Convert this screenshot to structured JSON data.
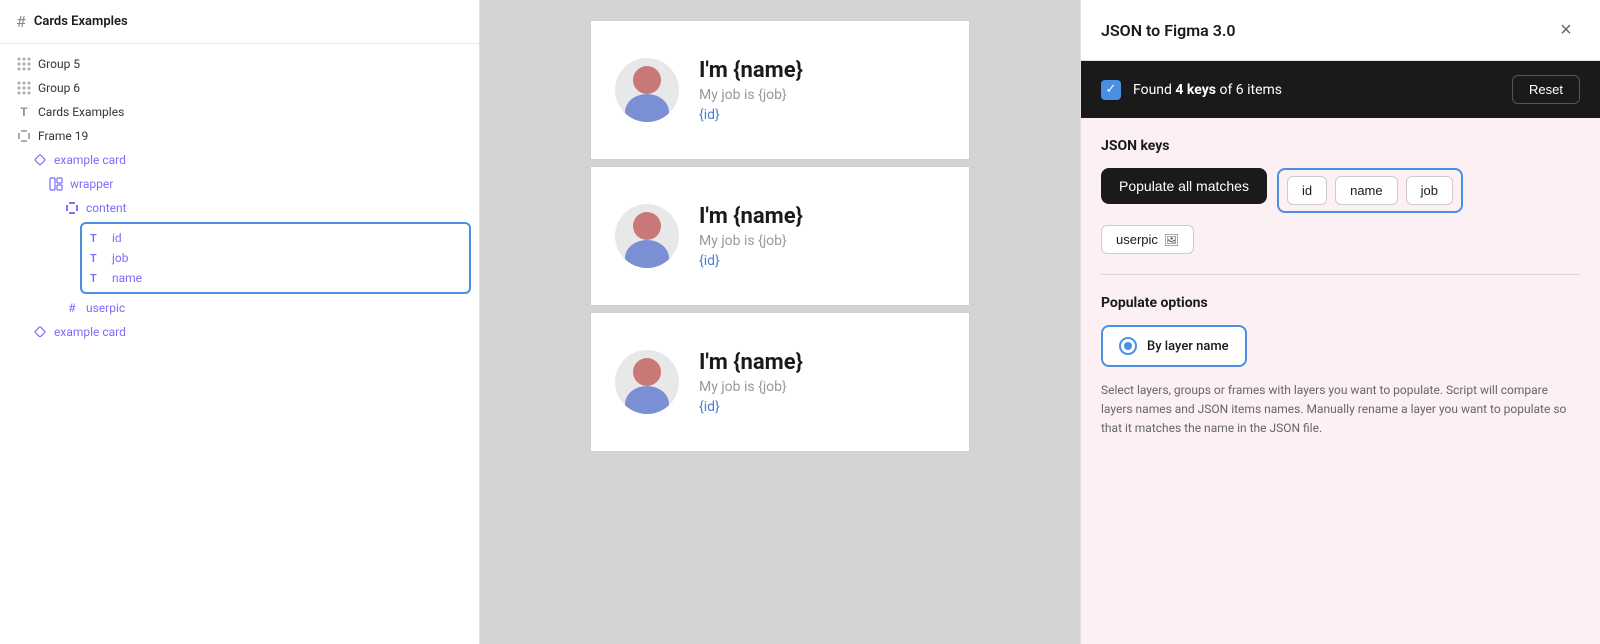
{
  "layers": {
    "header": {
      "icon": "#",
      "title": "Cards Examples"
    },
    "items": [
      {
        "id": "group5",
        "indent": 0,
        "icon": "grid",
        "label": "Group 5",
        "color": "default"
      },
      {
        "id": "group6",
        "indent": 0,
        "icon": "grid",
        "label": "Group 6",
        "color": "default"
      },
      {
        "id": "cards-examples",
        "indent": 0,
        "icon": "T",
        "label": "Cards Examples",
        "color": "default"
      },
      {
        "id": "frame19",
        "indent": 0,
        "icon": "frame",
        "label": "Frame 19",
        "color": "default"
      },
      {
        "id": "example-card-1",
        "indent": 1,
        "icon": "diamond",
        "label": "example card",
        "color": "blue"
      },
      {
        "id": "wrapper",
        "indent": 2,
        "icon": "layout",
        "label": "wrapper",
        "color": "blue"
      },
      {
        "id": "content",
        "indent": 3,
        "icon": "frame",
        "label": "content",
        "color": "blue"
      },
      {
        "id": "id-layer",
        "indent": 4,
        "icon": "T",
        "label": "id",
        "color": "blue",
        "selected": true
      },
      {
        "id": "job-layer",
        "indent": 4,
        "icon": "T",
        "label": "job",
        "color": "blue",
        "selected": true
      },
      {
        "id": "name-layer",
        "indent": 4,
        "icon": "T",
        "label": "name",
        "color": "blue",
        "selected": true
      },
      {
        "id": "userpic",
        "indent": 3,
        "icon": "hash",
        "label": "userpic",
        "color": "blue"
      },
      {
        "id": "example-card-2",
        "indent": 1,
        "icon": "diamond",
        "label": "example card",
        "color": "blue"
      }
    ]
  },
  "cards": [
    {
      "name": "I'm {name}",
      "job": "My job is {job}",
      "id": "{id}"
    },
    {
      "name": "I'm {name}",
      "job": "My job is {job}",
      "id": "{id}"
    },
    {
      "name": "I'm {name}",
      "job": "My job is {job}",
      "id": "{id}"
    }
  ],
  "right_panel": {
    "title": "JSON to Figma 3.0",
    "close_label": "×",
    "found_bar": {
      "keys_count": "4",
      "items_count": "6",
      "text_pre": "Found ",
      "text_keys": "4 keys",
      "text_of": " of ",
      "text_items": "6 items",
      "reset_label": "Reset"
    },
    "json_keys": {
      "section_title": "JSON keys",
      "populate_btn": "Populate all matches",
      "keys": [
        "id",
        "name",
        "job"
      ],
      "userpic_key": "userpic"
    },
    "populate_options": {
      "section_title": "Populate options",
      "by_layer_name": "By layer name",
      "description": "Select layers, groups or frames with layers you want to populate. Script will compare layers names and JSON items names. Manually rename a layer you want to populate so that it matches the name in the JSON file."
    }
  }
}
